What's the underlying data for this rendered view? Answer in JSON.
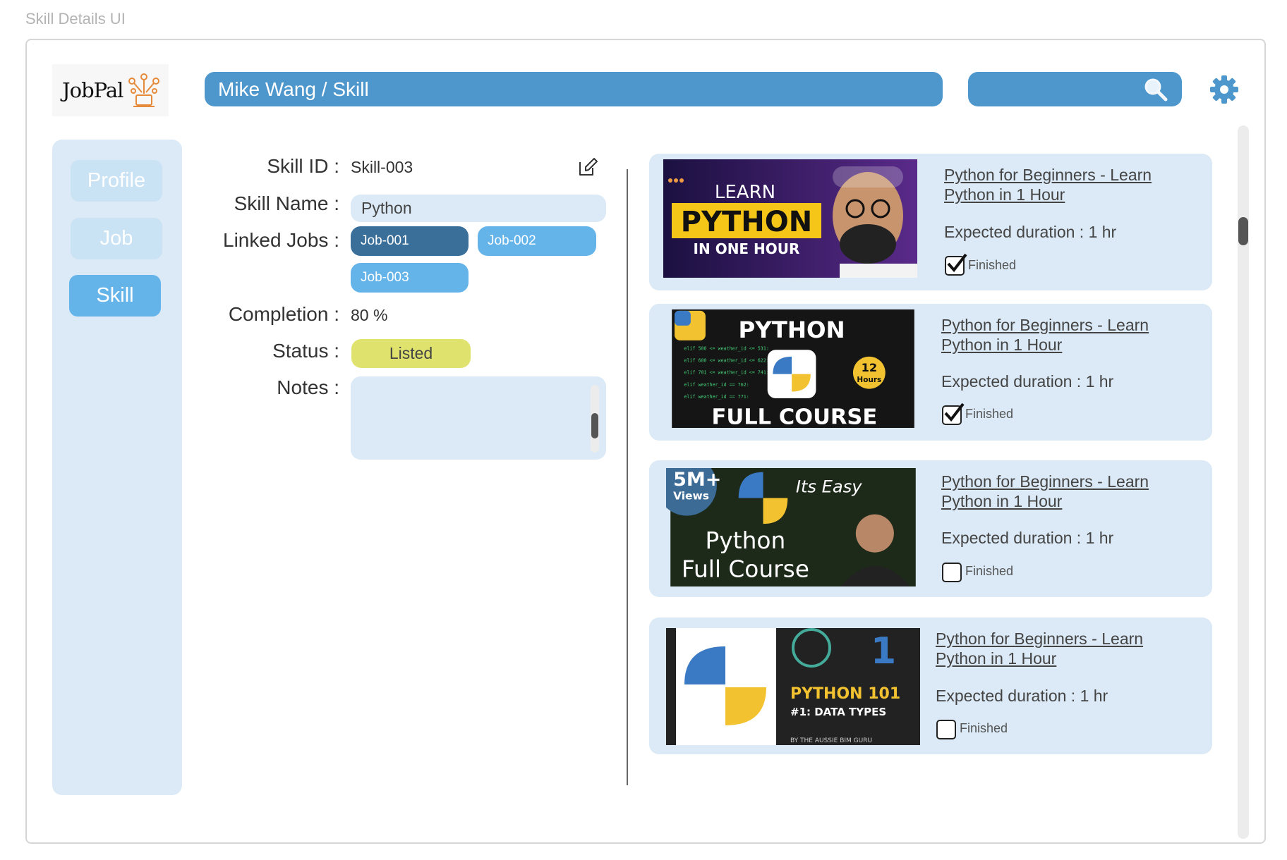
{
  "frame_label": "Skill Details UI",
  "header": {
    "logo_text": "JobPal",
    "breadcrumb": "Mike Wang / Skill",
    "search_placeholder": ""
  },
  "sidebar": {
    "items": [
      {
        "label": "Profile",
        "active": false
      },
      {
        "label": "Job",
        "active": false
      },
      {
        "label": "Skill",
        "active": true
      }
    ]
  },
  "skill": {
    "id_label": "Skill ID :",
    "id_value": "Skill-003",
    "name_label": "Skill Name :",
    "name_value": "Python",
    "linked_jobs_label": "Linked Jobs :",
    "linked_jobs": [
      "Job-001",
      "Job-002",
      "Job-003"
    ],
    "completion_label": "Completion :",
    "completion_value": "80 %",
    "status_label": "Status :",
    "status_value": "Listed",
    "notes_label": "Notes :",
    "notes_value": ""
  },
  "videos": [
    {
      "title_line1": "Python for Beginners - Learn",
      "title_line2": "Python in 1 Hour",
      "duration": "Expected duration : 1 hr",
      "finished_label": "Finished",
      "finished": true,
      "thumb_text": [
        "LEARN",
        "PYTHON",
        "IN ONE HOUR"
      ]
    },
    {
      "title_line1": "Python for Beginners - Learn",
      "title_line2": "Python in 1 Hour",
      "duration": "Expected duration : 1 hr",
      "finished_label": "Finished",
      "finished": true,
      "thumb_text": [
        "PYTHON",
        "FULL COURSE",
        "12",
        "Hours"
      ]
    },
    {
      "title_line1": "Python for Beginners - Learn",
      "title_line2": "Python in 1 Hour",
      "duration": "Expected duration : 1 hr",
      "finished_label": "Finished",
      "finished": false,
      "thumb_text": [
        "5M+",
        "Views",
        "Its Easy",
        "Python",
        "Full Course"
      ]
    },
    {
      "title_line1": "Python for Beginners - Learn",
      "title_line2": "Python in 1 Hour",
      "duration": "Expected duration : 1 hr",
      "finished_label": "Finished",
      "finished": false,
      "thumb_text": [
        "PYTHON 101",
        "#1: DATA TYPES",
        "BY THE AUSSIE BIM GURU",
        "1"
      ]
    }
  ],
  "colors": {
    "accent": "#4e97cc",
    "panel": "#dbeaf6",
    "nav_active": "#64b4ea",
    "chip_dark": "#3a6f9a",
    "chip_light": "#64b4ea",
    "status": "#dfe36e"
  }
}
